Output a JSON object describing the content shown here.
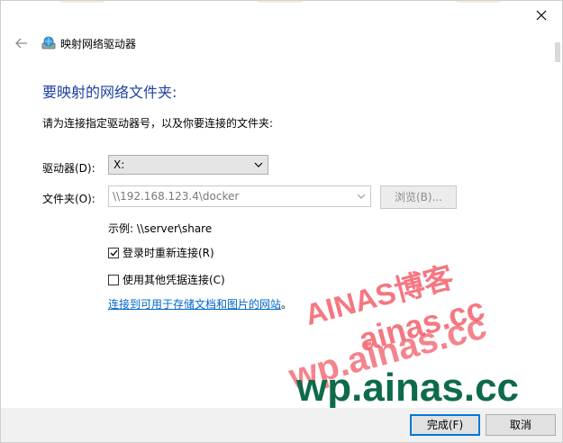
{
  "window": {
    "title": "映射网络驱动器",
    "close_glyph": "✕",
    "back_glyph": "←"
  },
  "main": {
    "heading": "要映射的网络文件夹:",
    "instruction": "请为连接指定驱动器号，以及你要连接的文件夹:",
    "drive_label": "驱动器(D):",
    "drive_value": "X:",
    "folder_label": "文件夹(O):",
    "folder_value": "\\\\192.168.123.4\\docker",
    "browse_label": "浏览(B)...",
    "example": "示例: \\\\server\\share",
    "reconnect_label": "登录时重新连接(R)",
    "reconnect_checked": true,
    "other_cred_label": "使用其他凭据连接(C)",
    "other_cred_checked": false,
    "link_text": "连接到可用于存储文档和图片的网站",
    "link_suffix": "。"
  },
  "watermark": {
    "line1": "AINAS博客",
    "line2": "ainas.cc",
    "line3": "wp.ainas.cc",
    "line4": "wp.ainas.cc"
  },
  "footer": {
    "finish_label": "完成(F)",
    "cancel_label": "取消"
  },
  "colors": {
    "heading": "#1f3f9e",
    "link": "#0066cc",
    "primary_border": "#0078d7",
    "watermark_red": "#ef1e2f",
    "watermark_green": "#0e6b4a"
  },
  "icons": {
    "back": "back-arrow-icon",
    "network_drive": "network-drive-icon",
    "close": "close-icon",
    "dropdown": "chevron-down-icon",
    "checkbox": "checkmark-icon"
  }
}
